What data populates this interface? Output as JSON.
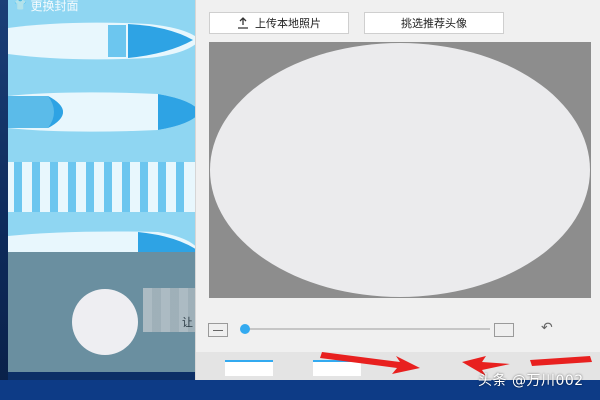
{
  "background_window": {
    "title": "更换封面",
    "blurred_text": "让"
  },
  "avatar_dialog": {
    "upload_label": "上传本地照片",
    "recommend_label": "挑选推荐头像",
    "zoom_level": 0.0
  },
  "watermark": "头条 @万川002",
  "colors": {
    "accent": "#33aaf0",
    "arrow": "#e8201f",
    "cover_sky": "#8fd6f2",
    "board_dark": "#2ea3e4"
  }
}
